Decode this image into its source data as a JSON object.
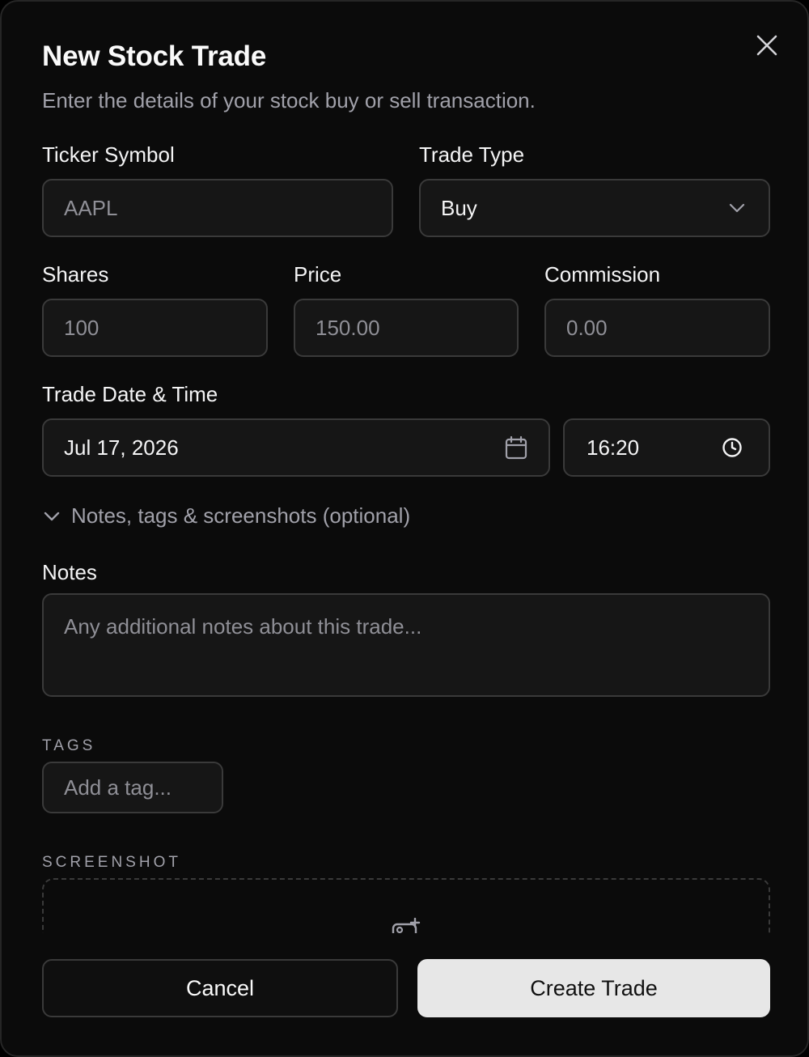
{
  "dialog": {
    "title": "New Stock Trade",
    "subtitle": "Enter the details of your stock buy or sell transaction."
  },
  "ticker": {
    "label": "Ticker Symbol",
    "placeholder": "AAPL"
  },
  "trade_type": {
    "label": "Trade Type",
    "value": "Buy",
    "options": [
      "Buy"
    ]
  },
  "shares": {
    "label": "Shares",
    "placeholder": "100"
  },
  "price": {
    "label": "Price",
    "placeholder": "150.00"
  },
  "commission": {
    "label": "Commission",
    "placeholder": "0.00"
  },
  "datetime": {
    "label": "Trade Date & Time",
    "date": "Jul 17, 2026",
    "time": "16:20"
  },
  "optional_section": {
    "label": "Notes, tags & screenshots (optional)",
    "expanded": true
  },
  "notes": {
    "label": "Notes",
    "placeholder": "Any additional notes about this trade..."
  },
  "tags": {
    "label": "TAGS",
    "placeholder": "Add a tag..."
  },
  "screenshot": {
    "label": "SCREENSHOT",
    "icon": "image-add-icon"
  },
  "footer": {
    "cancel_label": "Cancel",
    "create_label": "Create Trade"
  },
  "icons": {
    "close": "close-icon",
    "dropdown": "chevron-down-icon",
    "calendar": "calendar-icon",
    "clock": "clock-icon",
    "collapse": "chevron-down-icon"
  },
  "colors": {
    "background": "#0b0b0b",
    "field_bg": "#161616",
    "border": "#3a3a3a",
    "primary_button": "#e7e7e7",
    "muted_text": "#a1a1aa"
  }
}
